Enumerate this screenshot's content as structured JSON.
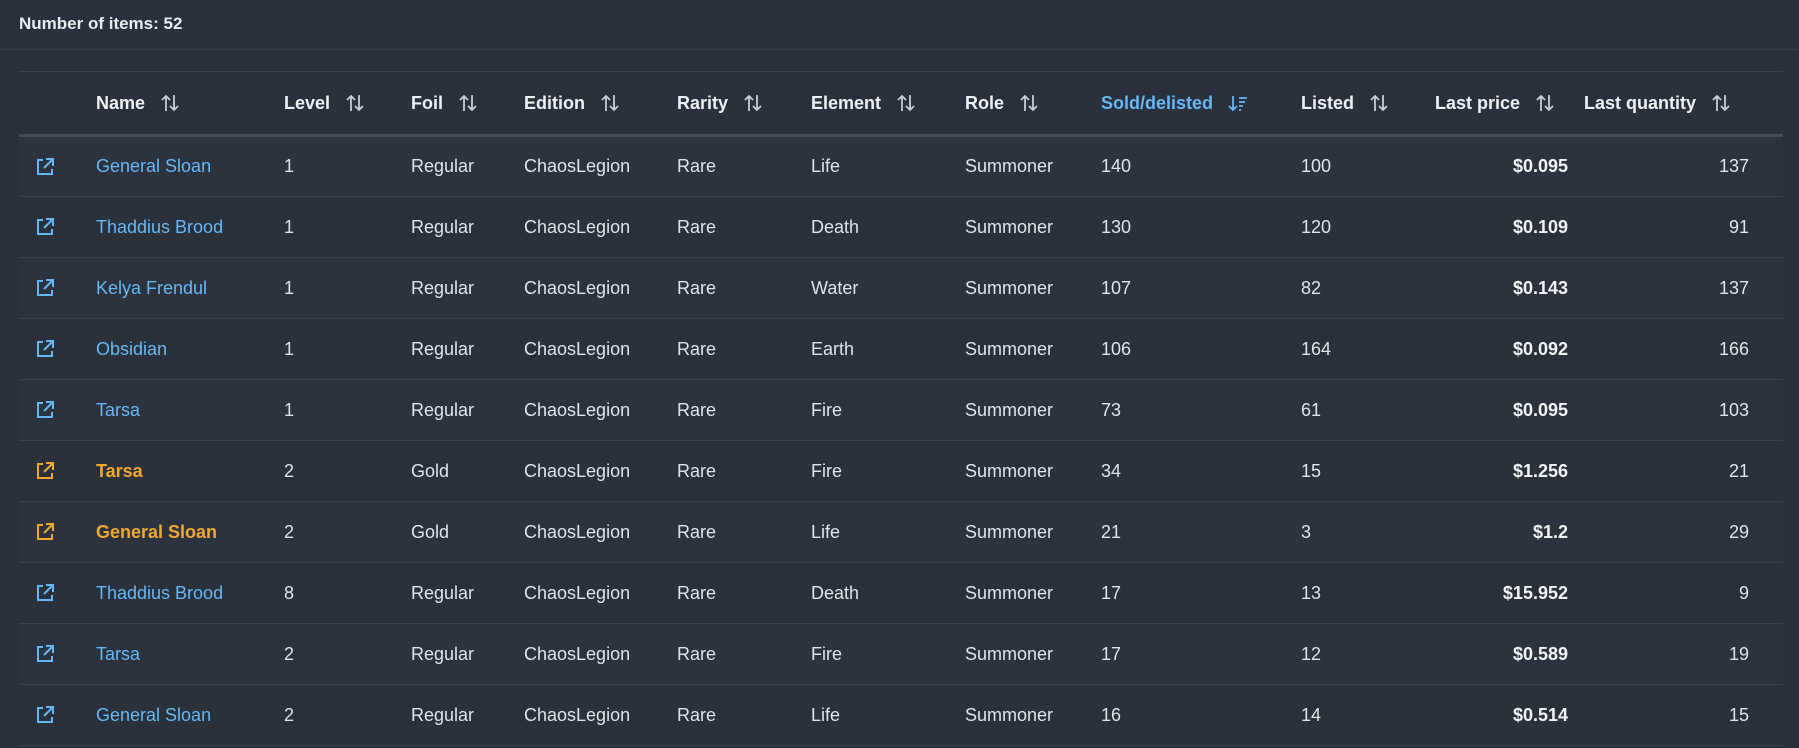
{
  "header": {
    "item_count_label": "Number of items: 52"
  },
  "colors": {
    "background": "#2a313c",
    "link": "#66b8f5",
    "gold": "#f0a830",
    "active_sort": "#66b8f5"
  },
  "columns": [
    {
      "key": "link",
      "label": ""
    },
    {
      "key": "name",
      "label": "Name"
    },
    {
      "key": "level",
      "label": "Level"
    },
    {
      "key": "foil",
      "label": "Foil"
    },
    {
      "key": "edition",
      "label": "Edition"
    },
    {
      "key": "rarity",
      "label": "Rarity"
    },
    {
      "key": "element",
      "label": "Element"
    },
    {
      "key": "role",
      "label": "Role"
    },
    {
      "key": "sold",
      "label": "Sold/delisted"
    },
    {
      "key": "listed",
      "label": "Listed"
    },
    {
      "key": "last_price",
      "label": "Last price"
    },
    {
      "key": "last_quantity",
      "label": "Last quantity"
    }
  ],
  "rows": [
    {
      "name": "General Sloan",
      "level": "1",
      "foil": "Regular",
      "edition": "ChaosLegion",
      "rarity": "Rare",
      "element": "Life",
      "role": "Summoner",
      "sold": "140",
      "listed": "100",
      "last_price": "$0.095",
      "last_quantity": "137"
    },
    {
      "name": "Thaddius Brood",
      "level": "1",
      "foil": "Regular",
      "edition": "ChaosLegion",
      "rarity": "Rare",
      "element": "Death",
      "role": "Summoner",
      "sold": "130",
      "listed": "120",
      "last_price": "$0.109",
      "last_quantity": "91"
    },
    {
      "name": "Kelya Frendul",
      "level": "1",
      "foil": "Regular",
      "edition": "ChaosLegion",
      "rarity": "Rare",
      "element": "Water",
      "role": "Summoner",
      "sold": "107",
      "listed": "82",
      "last_price": "$0.143",
      "last_quantity": "137"
    },
    {
      "name": "Obsidian",
      "level": "1",
      "foil": "Regular",
      "edition": "ChaosLegion",
      "rarity": "Rare",
      "element": "Earth",
      "role": "Summoner",
      "sold": "106",
      "listed": "164",
      "last_price": "$0.092",
      "last_quantity": "166"
    },
    {
      "name": "Tarsa",
      "level": "1",
      "foil": "Regular",
      "edition": "ChaosLegion",
      "rarity": "Rare",
      "element": "Fire",
      "role": "Summoner",
      "sold": "73",
      "listed": "61",
      "last_price": "$0.095",
      "last_quantity": "103"
    },
    {
      "name": "Tarsa",
      "level": "2",
      "foil": "Gold",
      "edition": "ChaosLegion",
      "rarity": "Rare",
      "element": "Fire",
      "role": "Summoner",
      "sold": "34",
      "listed": "15",
      "last_price": "$1.256",
      "last_quantity": "21"
    },
    {
      "name": "General Sloan",
      "level": "2",
      "foil": "Gold",
      "edition": "ChaosLegion",
      "rarity": "Rare",
      "element": "Life",
      "role": "Summoner",
      "sold": "21",
      "listed": "3",
      "last_price": "$1.2",
      "last_quantity": "29"
    },
    {
      "name": "Thaddius Brood",
      "level": "8",
      "foil": "Regular",
      "edition": "ChaosLegion",
      "rarity": "Rare",
      "element": "Death",
      "role": "Summoner",
      "sold": "17",
      "listed": "13",
      "last_price": "$15.952",
      "last_quantity": "9"
    },
    {
      "name": "Tarsa",
      "level": "2",
      "foil": "Regular",
      "edition": "ChaosLegion",
      "rarity": "Rare",
      "element": "Fire",
      "role": "Summoner",
      "sold": "17",
      "listed": "12",
      "last_price": "$0.589",
      "last_quantity": "19"
    },
    {
      "name": "General Sloan",
      "level": "2",
      "foil": "Regular",
      "edition": "ChaosLegion",
      "rarity": "Rare",
      "element": "Life",
      "role": "Summoner",
      "sold": "16",
      "listed": "14",
      "last_price": "$0.514",
      "last_quantity": "15"
    }
  ]
}
